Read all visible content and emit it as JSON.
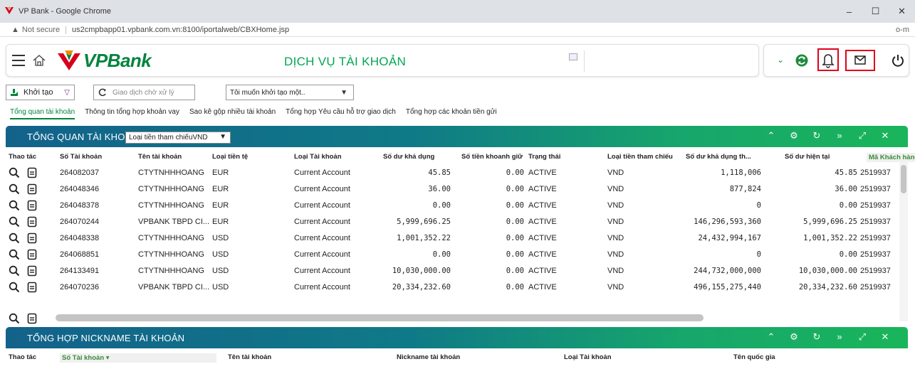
{
  "window": {
    "title": "VP Bank - Google Chrome",
    "minimize": "–",
    "maximize": "☐",
    "close": "✕"
  },
  "address": {
    "security": "Not secure",
    "url": "us2cmpbapp01.vpbank.com.vn:8100/iportalweb/CBXHome.jsp"
  },
  "header": {
    "brand": "VPBank",
    "page_title": "DỊCH VỤ TÀI KHOẢN"
  },
  "toolbar": {
    "create_label": "Khởi tạo",
    "pending_placeholder": "Giao dịch chờ xử lý",
    "select_label": "Tôi muốn khởi tạo một.."
  },
  "tabs": [
    "Tổng quan tài khoản",
    "Thông tin tổng hợp khoản vay",
    "Sao kê gộp nhiều tài khoản",
    "Tổng hợp Yêu cầu hỗ trợ giao dịch",
    "Tổng hợp các khoản tiền gửi"
  ],
  "overview": {
    "title": "TỔNG QUAN TÀI KHOẢN",
    "ref_currency_select": "Loại tiền tham chiếuVND",
    "columns": {
      "thao_tac": "Thao tác",
      "so_tk": "Số Tài khoản",
      "ten_tk": "Tên tài khoản",
      "loai_tien": "Loại tiền tệ",
      "loai_tk": "Loại Tài khoản",
      "so_du_kd": "Số dư khả dụng",
      "so_tien_kg": "Số tiền khoanh giữ",
      "trang_thai": "Trạng thái",
      "tien_tc": "Loại tiền tham chiếu",
      "so_du_kd_th": "Số dư khả dụng th...",
      "so_du_ht": "Số dư hiện tại",
      "ma_kh": "Mã Khách hàng ▾"
    },
    "rows": [
      {
        "acct": "264082037",
        "name": "CTYTNHHHOANG",
        "ccy": "EUR",
        "type": "Current Account",
        "avail": "45.85",
        "held": "0.00",
        "status": "ACTIVE",
        "ref": "VND",
        "avail_ref": "1,118,006",
        "current": "45.85",
        "cif": "2519937"
      },
      {
        "acct": "264048346",
        "name": "CTYTNHHHOANG",
        "ccy": "EUR",
        "type": "Current Account",
        "avail": "36.00",
        "held": "0.00",
        "status": "ACTIVE",
        "ref": "VND",
        "avail_ref": "877,824",
        "current": "36.00",
        "cif": "2519937"
      },
      {
        "acct": "264048378",
        "name": "CTYTNHHHOANG",
        "ccy": "EUR",
        "type": "Current Account",
        "avail": "0.00",
        "held": "0.00",
        "status": "ACTIVE",
        "ref": "VND",
        "avail_ref": "0",
        "current": "0.00",
        "cif": "2519937"
      },
      {
        "acct": "264070244",
        "name": "VPBANK TBPD CI...",
        "ccy": "EUR",
        "type": "Current Account",
        "avail": "5,999,696.25",
        "held": "0.00",
        "status": "ACTIVE",
        "ref": "VND",
        "avail_ref": "146,296,593,360",
        "current": "5,999,696.25",
        "cif": "2519937"
      },
      {
        "acct": "264048338",
        "name": "CTYTNHHHOANG",
        "ccy": "USD",
        "type": "Current Account",
        "avail": "1,001,352.22",
        "held": "0.00",
        "status": "ACTIVE",
        "ref": "VND",
        "avail_ref": "24,432,994,167",
        "current": "1,001,352.22",
        "cif": "2519937"
      },
      {
        "acct": "264068851",
        "name": "CTYTNHHHOANG",
        "ccy": "USD",
        "type": "Current Account",
        "avail": "0.00",
        "held": "0.00",
        "status": "ACTIVE",
        "ref": "VND",
        "avail_ref": "0",
        "current": "0.00",
        "cif": "2519937"
      },
      {
        "acct": "264133491",
        "name": "CTYTNHHHOANG",
        "ccy": "USD",
        "type": "Current Account",
        "avail": "10,030,000.00",
        "held": "0.00",
        "status": "ACTIVE",
        "ref": "VND",
        "avail_ref": "244,732,000,000",
        "current": "10,030,000.00",
        "cif": "2519937"
      },
      {
        "acct": "264070236",
        "name": "VPBANK TBPD CI...",
        "ccy": "USD",
        "type": "Current Account",
        "avail": "20,334,232.60",
        "held": "0.00",
        "status": "ACTIVE",
        "ref": "VND",
        "avail_ref": "496,155,275,440",
        "current": "20,334,232.60",
        "cif": "2519937"
      }
    ]
  },
  "nickname": {
    "title": "TỔNG HỢP NICKNAME TÀI KHOẢN",
    "columns": {
      "thao_tac": "Thao tác",
      "so_tk": "Số Tài khoản ▾",
      "ten_tk": "Tên tài khoản",
      "nickname": "Nickname tài khoản",
      "loai_tk": "Loại Tài khoản",
      "quoc_gia": "Tên quốc gia"
    }
  }
}
